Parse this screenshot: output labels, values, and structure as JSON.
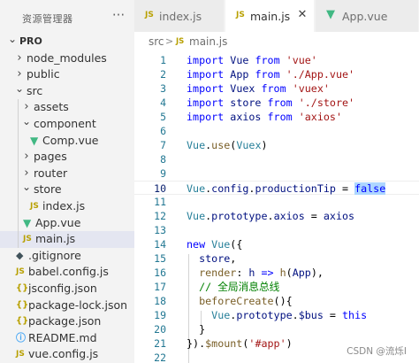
{
  "explorer": {
    "title": "资源管理器",
    "more_icon": "ellipsis-icon",
    "tree": [
      {
        "label": "PRO",
        "type": "folder",
        "expanded": true,
        "depth": 0
      },
      {
        "label": "node_modules",
        "type": "folder",
        "expanded": false,
        "depth": 1
      },
      {
        "label": "public",
        "type": "folder",
        "expanded": false,
        "depth": 1
      },
      {
        "label": "src",
        "type": "folder",
        "expanded": true,
        "depth": 1
      },
      {
        "label": "assets",
        "type": "folder",
        "expanded": false,
        "depth": 2
      },
      {
        "label": "component",
        "type": "folder",
        "expanded": true,
        "depth": 2
      },
      {
        "label": "Comp.vue",
        "type": "vue",
        "depth": 3
      },
      {
        "label": "pages",
        "type": "folder",
        "expanded": false,
        "depth": 2
      },
      {
        "label": "router",
        "type": "folder",
        "expanded": false,
        "depth": 2
      },
      {
        "label": "store",
        "type": "folder",
        "expanded": true,
        "depth": 2
      },
      {
        "label": "index.js",
        "type": "js",
        "depth": 3
      },
      {
        "label": "App.vue",
        "type": "vue",
        "depth": 2
      },
      {
        "label": "main.js",
        "type": "js",
        "depth": 2,
        "selected": true
      },
      {
        "label": ".gitignore",
        "type": "git",
        "depth": 1
      },
      {
        "label": "babel.config.js",
        "type": "js",
        "depth": 1
      },
      {
        "label": "jsconfig.json",
        "type": "json",
        "depth": 1
      },
      {
        "label": "package-lock.json",
        "type": "json",
        "depth": 1
      },
      {
        "label": "package.json",
        "type": "json",
        "depth": 1
      },
      {
        "label": "README.md",
        "type": "info",
        "depth": 1
      },
      {
        "label": "vue.config.js",
        "type": "js",
        "depth": 1
      }
    ]
  },
  "tabs": [
    {
      "label": "index.js",
      "type": "js",
      "active": false
    },
    {
      "label": "main.js",
      "type": "js",
      "active": true
    },
    {
      "label": "App.vue",
      "type": "vue",
      "active": false
    }
  ],
  "breadcrumb": {
    "folder": "src",
    "separator": ">",
    "file": "main.js"
  },
  "editor": {
    "current_line": 10,
    "lines": [
      {
        "n": "1",
        "tokens": [
          [
            "kw",
            "import"
          ],
          [
            "pl",
            " "
          ],
          [
            "var",
            "Vue"
          ],
          [
            "pl",
            " "
          ],
          [
            "kw",
            "from"
          ],
          [
            "pl",
            " "
          ],
          [
            "str",
            "'vue'"
          ]
        ]
      },
      {
        "n": "2",
        "tokens": [
          [
            "kw",
            "import"
          ],
          [
            "pl",
            " "
          ],
          [
            "var",
            "App"
          ],
          [
            "pl",
            " "
          ],
          [
            "kw",
            "from"
          ],
          [
            "pl",
            " "
          ],
          [
            "str",
            "'./App.vue'"
          ]
        ]
      },
      {
        "n": "3",
        "tokens": [
          [
            "kw",
            "import"
          ],
          [
            "pl",
            " "
          ],
          [
            "var",
            "Vuex"
          ],
          [
            "pl",
            " "
          ],
          [
            "kw",
            "from"
          ],
          [
            "pl",
            " "
          ],
          [
            "str",
            "'vuex'"
          ]
        ]
      },
      {
        "n": "4",
        "tokens": [
          [
            "kw",
            "import"
          ],
          [
            "pl",
            " "
          ],
          [
            "var",
            "store"
          ],
          [
            "pl",
            " "
          ],
          [
            "kw",
            "from"
          ],
          [
            "pl",
            " "
          ],
          [
            "str",
            "'./store'"
          ]
        ]
      },
      {
        "n": "5",
        "tokens": [
          [
            "kw",
            "import"
          ],
          [
            "pl",
            " "
          ],
          [
            "var",
            "axios"
          ],
          [
            "pl",
            " "
          ],
          [
            "kw",
            "from"
          ],
          [
            "pl",
            " "
          ],
          [
            "str",
            "'axios'"
          ]
        ]
      },
      {
        "n": "6",
        "tokens": []
      },
      {
        "n": "7",
        "tokens": [
          [
            "cls",
            "Vue"
          ],
          [
            "pl",
            "."
          ],
          [
            "fn",
            "use"
          ],
          [
            "pl",
            "("
          ],
          [
            "cls",
            "Vuex"
          ],
          [
            "pl",
            ")"
          ]
        ]
      },
      {
        "n": "8",
        "tokens": []
      },
      {
        "n": "9",
        "tokens": []
      },
      {
        "n": "10",
        "tokens": [
          [
            "cls",
            "Vue"
          ],
          [
            "pl",
            "."
          ],
          [
            "var",
            "config"
          ],
          [
            "pl",
            "."
          ],
          [
            "var",
            "productionTip"
          ],
          [
            "pl",
            " = "
          ],
          [
            "bool",
            "false"
          ]
        ]
      },
      {
        "n": "11",
        "tokens": []
      },
      {
        "n": "12",
        "tokens": [
          [
            "cls",
            "Vue"
          ],
          [
            "pl",
            "."
          ],
          [
            "var",
            "prototype"
          ],
          [
            "pl",
            "."
          ],
          [
            "var",
            "axios"
          ],
          [
            "pl",
            " = "
          ],
          [
            "var",
            "axios"
          ]
        ]
      },
      {
        "n": "13",
        "tokens": []
      },
      {
        "n": "14",
        "tokens": [
          [
            "kw",
            "new"
          ],
          [
            "pl",
            " "
          ],
          [
            "cls",
            "Vue"
          ],
          [
            "pl",
            "({"
          ]
        ]
      },
      {
        "n": "15",
        "tokens": [
          [
            "pl",
            "  "
          ],
          [
            "var",
            "store"
          ],
          [
            "pl",
            ","
          ]
        ]
      },
      {
        "n": "16",
        "tokens": [
          [
            "pl",
            "  "
          ],
          [
            "fn",
            "render"
          ],
          [
            "pl",
            ": "
          ],
          [
            "var",
            "h"
          ],
          [
            "pl",
            " "
          ],
          [
            "kw",
            "=>"
          ],
          [
            "pl",
            " "
          ],
          [
            "fn",
            "h"
          ],
          [
            "pl",
            "("
          ],
          [
            "var",
            "App"
          ],
          [
            "pl",
            "),"
          ]
        ]
      },
      {
        "n": "17",
        "tokens": [
          [
            "pl",
            "  "
          ],
          [
            "cm",
            "// 全局消息总线"
          ]
        ]
      },
      {
        "n": "18",
        "tokens": [
          [
            "pl",
            "  "
          ],
          [
            "fn",
            "beforeCreate"
          ],
          [
            "pl",
            "(){"
          ]
        ]
      },
      {
        "n": "19",
        "tokens": [
          [
            "pl",
            "    "
          ],
          [
            "cls",
            "Vue"
          ],
          [
            "pl",
            "."
          ],
          [
            "var",
            "prototype"
          ],
          [
            "pl",
            "."
          ],
          [
            "var",
            "$bus"
          ],
          [
            "pl",
            " = "
          ],
          [
            "kw",
            "this"
          ]
        ]
      },
      {
        "n": "20",
        "tokens": [
          [
            "pl",
            "  }"
          ]
        ]
      },
      {
        "n": "21",
        "tokens": [
          [
            "pl",
            "})."
          ],
          [
            "fn",
            "$mount"
          ],
          [
            "pl",
            "("
          ],
          [
            "str",
            "'#app'"
          ],
          [
            "pl",
            ")"
          ]
        ]
      },
      {
        "n": "22",
        "tokens": []
      }
    ]
  },
  "watermark": "CSDN @流烁I"
}
